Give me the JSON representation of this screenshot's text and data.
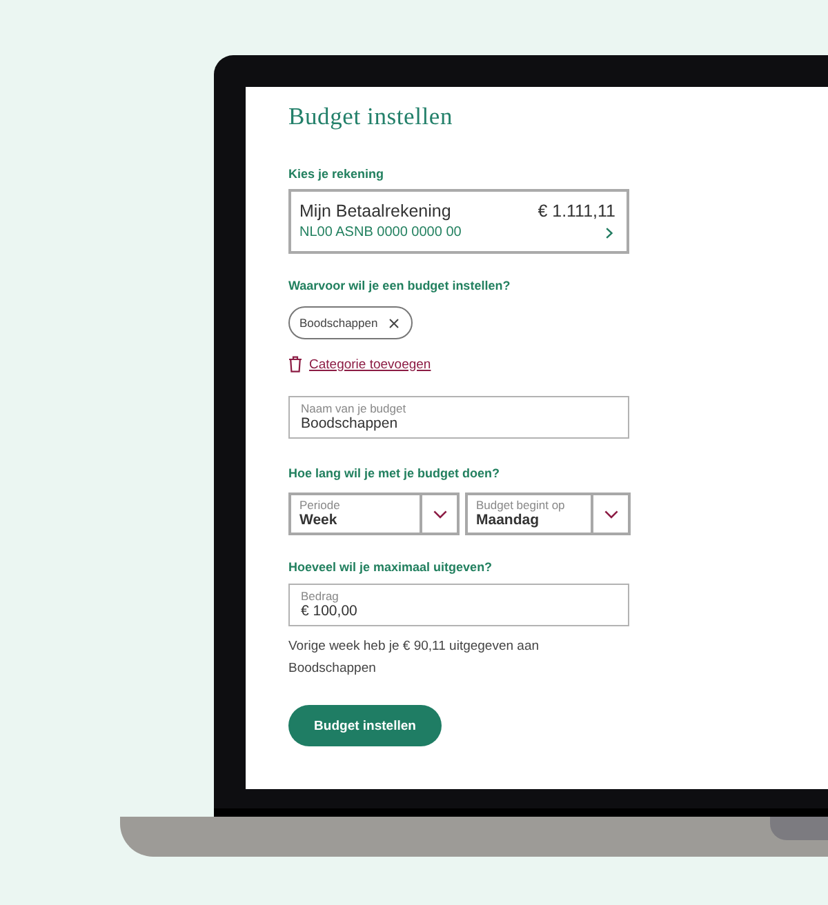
{
  "title": "Budget instellen",
  "account_section": {
    "label": "Kies je rekening",
    "account": {
      "name": "Mijn Betaalrekening",
      "balance": "€ 1.111,11",
      "iban": "NL00 ASNB 0000 0000 00"
    }
  },
  "category_section": {
    "label": "Waarvoor wil je een budget instellen?",
    "chips": [
      {
        "label": "Boodschappen"
      }
    ],
    "add_link": "Categorie toevoegen"
  },
  "name_field": {
    "label": "Naam van je budget",
    "value": "Boodschappen"
  },
  "period_section": {
    "label": "Hoe lang wil je met je budget doen?",
    "selects": [
      {
        "label": "Periode",
        "value": "Week"
      },
      {
        "label": "Budget begint op",
        "value": "Maandag"
      }
    ]
  },
  "amount_section": {
    "label": "Hoeveel wil je maximaal uitgeven?",
    "field": {
      "label": "Bedrag",
      "value": "€ 100,00"
    },
    "hint": "Vorige week heb je € 90,11 uitgegeven aan Boodschappen"
  },
  "submit_button": "Budget instellen"
}
